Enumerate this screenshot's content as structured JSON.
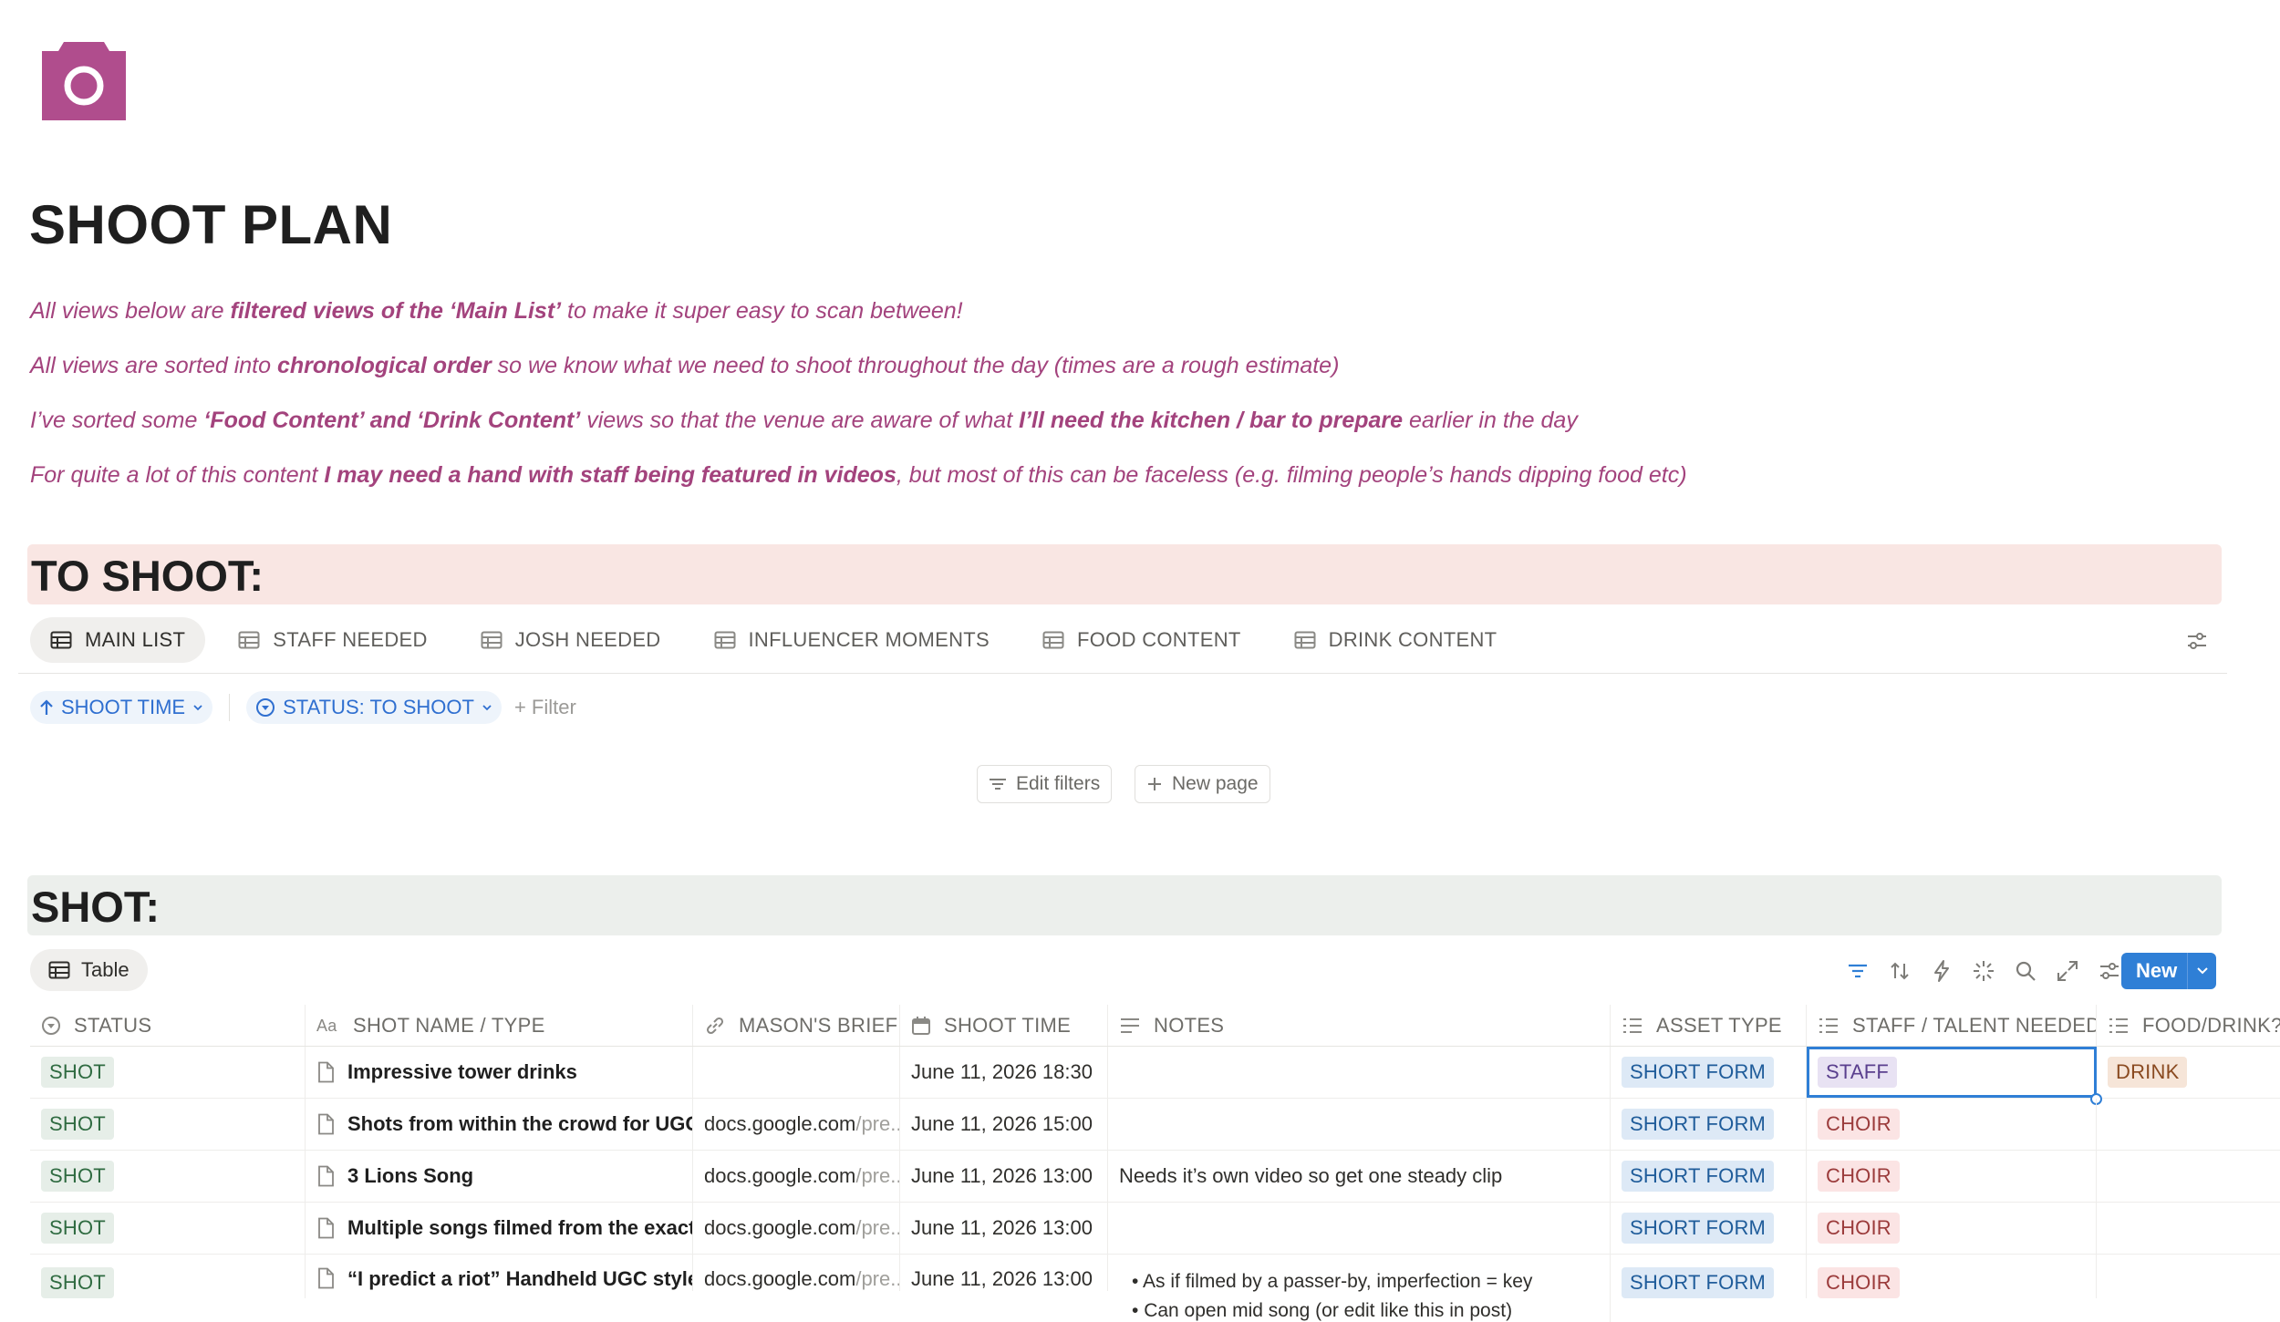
{
  "page": {
    "title": "SHOOT PLAN",
    "icon": "camera-icon",
    "accent_color": "#b04d8d"
  },
  "intro": [
    {
      "parts": [
        {
          "t": "All views below are ",
          "b": false
        },
        {
          "t": "filtered views of the ‘Main List’",
          "b": true
        },
        {
          "t": " to make it super easy to scan between!",
          "b": false
        }
      ]
    },
    {
      "parts": [
        {
          "t": "All views are sorted into ",
          "b": false
        },
        {
          "t": "chronological order",
          "b": true
        },
        {
          "t": " so we know what we need to shoot throughout the day (times are a rough estimate)",
          "b": false
        }
      ]
    },
    {
      "parts": [
        {
          "t": "I’ve sorted some ",
          "b": false
        },
        {
          "t": "‘Food Content’ and ‘Drink Content’",
          "b": true
        },
        {
          "t": " views so that the venue are aware of what ",
          "b": false
        },
        {
          "t": "I’ll need the kitchen / bar to prepare",
          "b": true
        },
        {
          "t": " earlier in the day",
          "b": false
        }
      ]
    },
    {
      "parts": [
        {
          "t": "For quite a lot of this content ",
          "b": false
        },
        {
          "t": "I may need a hand with staff being featured in videos",
          "b": true
        },
        {
          "t": ", but most of this can be faceless (e.g. filming people’s hands dipping food etc)",
          "b": false
        }
      ]
    }
  ],
  "to_shoot": {
    "heading": "TO SHOOT:",
    "tabs": [
      "MAIN LIST",
      "STAFF NEEDED",
      "JOSH NEEDED",
      "INFLUENCER MOMENTS",
      "FOOD CONTENT",
      "DRINK CONTENT"
    ],
    "active_tab": "MAIN LIST",
    "sort_pill": "SHOOT TIME",
    "status_pill": "STATUS: TO SHOOT",
    "add_filter": "Filter",
    "edit_filters": "Edit filters",
    "new_page": "New page"
  },
  "shot": {
    "heading": "SHOT:",
    "view_tab": "Table",
    "new_button": "New",
    "columns": [
      "STATUS",
      "SHOT NAME / TYPE",
      "MASON'S BRIEF",
      "SHOOT TIME",
      "NOTES",
      "ASSET TYPE",
      "STAFF / TALENT NEEDED",
      "FOOD/DRINK?"
    ],
    "rows": [
      {
        "status": "SHOT",
        "name": "Impressive tower drinks",
        "brief_host": "",
        "brief_path": "",
        "time": "June 11, 2026 18:30",
        "notes": "",
        "notes_list": [],
        "asset": "SHORT FORM",
        "talent": "STAFF",
        "food": "DRINK"
      },
      {
        "status": "SHOT",
        "name": "Shots from within the crowd for UGC feel",
        "brief_host": "docs.google.com",
        "brief_path": "/pre...",
        "time": "June 11, 2026 15:00",
        "notes": "",
        "notes_list": [],
        "asset": "SHORT FORM",
        "talent": "CHOIR",
        "food": ""
      },
      {
        "status": "SHOT",
        "name": "3 Lions Song",
        "brief_host": "docs.google.com",
        "brief_path": "/pre...",
        "time": "June 11, 2026 13:00",
        "notes": "Needs it’s own video so get one steady clip",
        "notes_list": [],
        "asset": "SHORT FORM",
        "talent": "CHOIR",
        "food": ""
      },
      {
        "status": "SHOT",
        "name": "Multiple songs filmed from the exact same angle",
        "brief_host": "docs.google.com",
        "brief_path": "/pre...",
        "time": "June 11, 2026 13:00",
        "notes": "",
        "notes_list": [],
        "asset": "SHORT FORM",
        "talent": "CHOIR",
        "food": ""
      },
      {
        "status": "SHOT",
        "name": "“I predict a riot” Handheld UGC style video",
        "brief_host": "docs.google.com",
        "brief_path": "/pre...",
        "time": "June 11, 2026 13:00",
        "notes": "",
        "notes_list": [
          "As if filmed by a passer-by, imperfection = key",
          "Can open mid song (or edit like this in post)"
        ],
        "asset": "SHORT FORM",
        "talent": "CHOIR",
        "food": ""
      }
    ]
  },
  "colors": {
    "intro_text": "#a3437d",
    "to_shoot_band": "#f9e6e3",
    "shot_band": "#ecefec",
    "filter_pill": "#2f6fd0",
    "new_button": "#2f7fd6"
  }
}
